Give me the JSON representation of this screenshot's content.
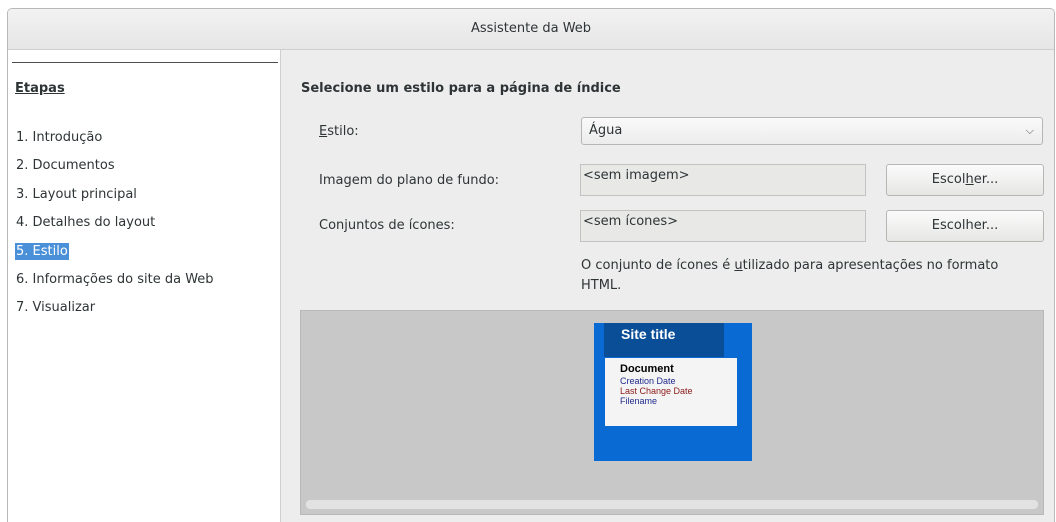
{
  "window": {
    "title": "Assistente da Web"
  },
  "sidebar": {
    "heading": "Etapas",
    "steps": [
      {
        "label": "1. Introdução",
        "selected": false
      },
      {
        "label": "2. Documentos",
        "selected": false
      },
      {
        "label": "3. Layout principal",
        "selected": false
      },
      {
        "label": "4. Detalhes do layout",
        "selected": false
      },
      {
        "label": "5. Estilo",
        "selected": true
      },
      {
        "label": "6. Informações do site da Web",
        "selected": false
      },
      {
        "label": "7. Visualizar",
        "selected": false
      }
    ]
  },
  "main": {
    "heading": "Selecione um estilo para a página de índice",
    "style": {
      "label_pre": "E",
      "label_rest": "stilo:",
      "value": "Água"
    },
    "background": {
      "label": "Imagem do plano de fundo:",
      "value": "<sem imagem>",
      "button_pre": "Escol",
      "button_u": "h",
      "button_post": "er..."
    },
    "icons": {
      "label": "Conjuntos de ícones:",
      "value": "<sem ícones>",
      "button": "Escolher..."
    },
    "note_pre": "O conjunto de ícones é ",
    "note_u": "u",
    "note_post": "tilizado para apresentações no formato HTML.",
    "preview": {
      "site_title": "Site title",
      "document": "Document",
      "creation_date": "Creation Date",
      "last_change_date": "Last Change Date",
      "filename": "Filename",
      "colors": {
        "background": "#0a6ad3",
        "title_box": "#0a4e97",
        "creation": "#1f2b8c",
        "last_change": "#8b1a1a",
        "filename": "#1f2b8c"
      }
    }
  }
}
